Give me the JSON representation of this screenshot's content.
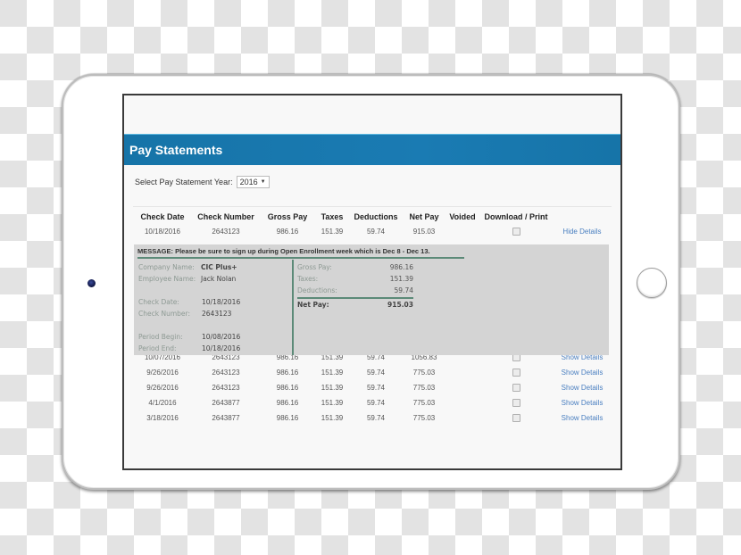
{
  "page": {
    "title": "Pay Statements",
    "year_label": "Select Pay Statement Year:",
    "year_value": "2016",
    "year_arrow": "▼"
  },
  "table": {
    "headers": [
      "Check Date",
      "Check Number",
      "Gross Pay",
      "Taxes",
      "Deductions",
      "Net Pay",
      "Voided",
      "Download / Print"
    ],
    "expanded_row": {
      "date": "10/18/2016",
      "number": "2643123",
      "gross": "986.16",
      "taxes": "151.39",
      "deductions": "59.74",
      "net": "915.03",
      "voided": "",
      "download_checked": false,
      "link": "Hide Details"
    },
    "rows": [
      {
        "date": "10/07/2016",
        "number": "2643123",
        "gross": "986.16",
        "taxes": "151.39",
        "deductions": "59.74",
        "net": "1056.83",
        "voided": "",
        "download_checked": false,
        "link": "Show Details"
      },
      {
        "date": "9/26/2016",
        "number": "2643123",
        "gross": "986.16",
        "taxes": "151.39",
        "deductions": "59.74",
        "net": "775.03",
        "voided": "",
        "download_checked": false,
        "link": "Show Details"
      },
      {
        "date": "9/26/2016",
        "number": "2643123",
        "gross": "986.16",
        "taxes": "151.39",
        "deductions": "59.74",
        "net": "775.03",
        "voided": "",
        "download_checked": false,
        "link": "Show Details"
      },
      {
        "date": "4/1/2016",
        "number": "2643877",
        "gross": "986.16",
        "taxes": "151.39",
        "deductions": "59.74",
        "net": "775.03",
        "voided": "",
        "download_checked": false,
        "link": "Show Details"
      },
      {
        "date": "3/18/2016",
        "number": "2643877",
        "gross": "986.16",
        "taxes": "151.39",
        "deductions": "59.74",
        "net": "775.03",
        "voided": "",
        "download_checked": false,
        "link": "Show Details"
      }
    ]
  },
  "details": {
    "message": "MESSAGE: Please be sure to sign up during Open Enrollment week which is Dec 8 - Dec 13.",
    "company_label": "Company Name:",
    "company_value": "CIC Plus+",
    "employee_label": "Employee Name:",
    "employee_value": "Jack Nolan",
    "check_date_label": "Check Date:",
    "check_date_value": "10/18/2016",
    "check_number_label": "Check Number:",
    "check_number_value": "2643123",
    "period_begin_label": "Period Begin:",
    "period_begin_value": "10/08/2016",
    "period_end_label": "Period End:",
    "period_end_value": "10/18/2016",
    "gross_label": "Gross Pay:",
    "gross_value": "986.16",
    "taxes_label": "Taxes:",
    "taxes_value": "151.39",
    "deductions_label": "Deductions:",
    "deductions_value": "59.74",
    "net_label": "Net Pay:",
    "net_value": "915.03"
  },
  "colors": {
    "header_blue": "#1a7bb3",
    "link_blue": "#4a7fc0",
    "accent_green": "#5c8a78",
    "panel_grey": "#d4d4d4"
  }
}
